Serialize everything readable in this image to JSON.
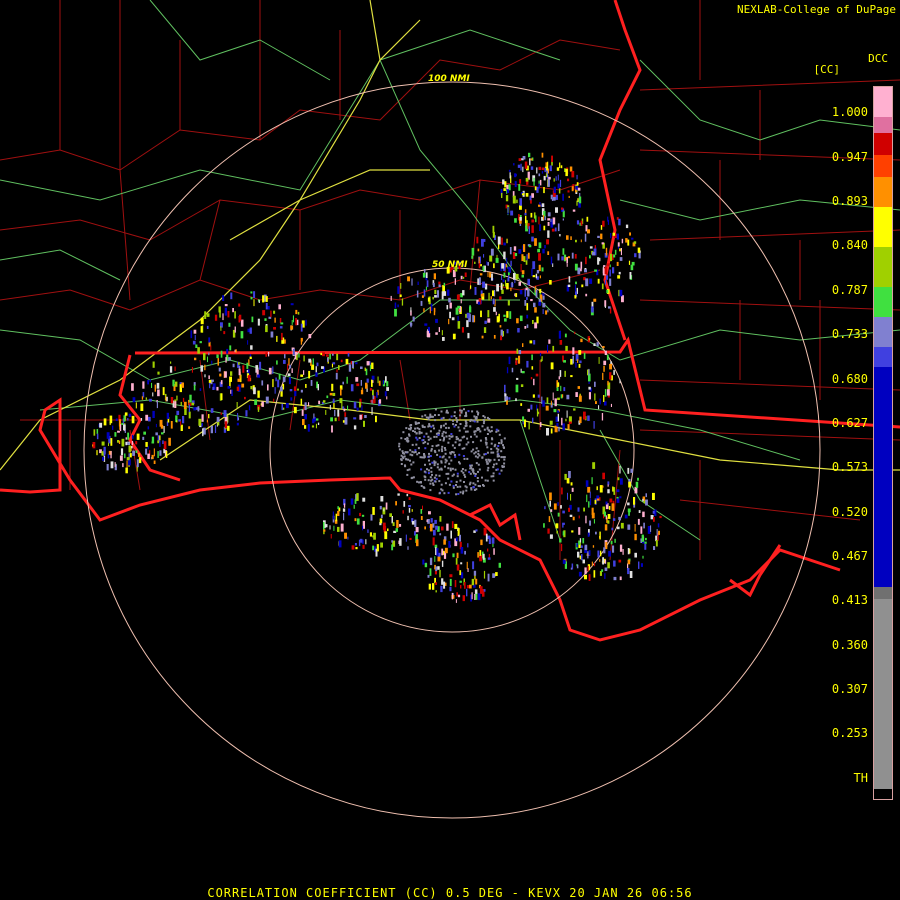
{
  "header": {
    "credit": "NEXLAB-College of DuPage",
    "site_code": "DCC",
    "product_code": "[CC]"
  },
  "footer": {
    "caption": "CORRELATION COEFFICIENT (CC) 0.5 DEG - KEVX 20 JAN 26 06:56"
  },
  "range_rings": {
    "inner_label": "50 NMI",
    "outer_label": "100 NMI"
  },
  "legend": {
    "ticks": [
      "1.000",
      "0.947",
      "0.893",
      "0.840",
      "0.787",
      "0.733",
      "0.680",
      "0.627",
      "0.573",
      "0.520",
      "0.467",
      "0.413",
      "0.360",
      "0.307",
      "0.253",
      "TH"
    ],
    "colors": [
      "#ffb0d0",
      "#e070a0",
      "#d00000",
      "#ff4000",
      "#ff9000",
      "#ffff00",
      "#a0d000",
      "#40e040",
      "#8080d0",
      "#4040e0",
      "#0000c0",
      "#707070",
      "#909090",
      "#000000"
    ]
  },
  "colors": {
    "state_border": "#ff2020",
    "county_border": "#a01010",
    "highway": "#60c060",
    "interstate": "#e0e040",
    "range_ring": "#f0c0b0",
    "text": "#ffff00"
  }
}
